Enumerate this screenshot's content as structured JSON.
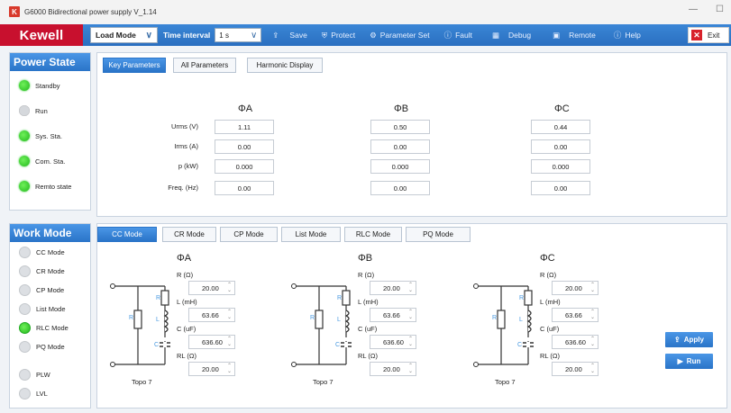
{
  "window": {
    "title": "G6000 Bidirectional power supply V_1.14",
    "logo_letter": "K",
    "min": "—",
    "max": "☐"
  },
  "toolbar": {
    "brand": "Kewell",
    "load_mode": "Load Mode",
    "time_interval_label": "Time interval",
    "time_interval_value": "1 s",
    "save": "Save",
    "protect": "Protect",
    "parameter_set": "Parameter Set",
    "fault": "Fault",
    "debug": "Debug",
    "remote": "Remote",
    "help": "Help",
    "exit": "Exit"
  },
  "power_state": {
    "title": "Power State",
    "items": [
      {
        "label": "Standby",
        "on": true
      },
      {
        "label": "Run",
        "on": false
      },
      {
        "label": "Sys. Sta.",
        "on": true
      },
      {
        "label": "Com. Sta.",
        "on": true
      },
      {
        "label": "Remto state",
        "on": true
      }
    ]
  },
  "work_mode": {
    "title": "Work Mode",
    "items": [
      {
        "label": "CC Mode",
        "on": false
      },
      {
        "label": "CR Mode",
        "on": false
      },
      {
        "label": "CP Mode",
        "on": false
      },
      {
        "label": "List Mode",
        "on": false
      },
      {
        "label": "RLC Mode",
        "on": true
      },
      {
        "label": "PQ Mode",
        "on": false
      },
      {
        "label": "PLW",
        "on": false
      },
      {
        "label": "LVL",
        "on": false
      }
    ]
  },
  "param_tabs": [
    "Key Parameters",
    "All Parameters",
    "Harmonic Display"
  ],
  "params": {
    "phases": [
      "ΦA",
      "ΦB",
      "ΦC"
    ],
    "rows": [
      {
        "label": "Urms (V)",
        "values": [
          "1.11",
          "0.50",
          "0.44"
        ]
      },
      {
        "label": "Irms (A)",
        "values": [
          "0.00",
          "0.00",
          "0.00"
        ]
      },
      {
        "label": "p (kW)",
        "values": [
          "0.000",
          "0.000",
          "0.000"
        ]
      },
      {
        "label": "Freq. (Hz)",
        "values": [
          "0.00",
          "0.00",
          "0.00"
        ]
      }
    ]
  },
  "mode_tabs": [
    "CC Mode",
    "CR Mode",
    "CP Mode",
    "List Mode",
    "RLC Mode",
    "PQ Mode"
  ],
  "rlc": {
    "phases": [
      {
        "name": "ΦA",
        "r_label": "R (Ω)",
        "r": "20.00",
        "l_label": "L (mH)",
        "l": "63.66",
        "c_label": "C (uF)",
        "c": "636.60",
        "rl_label": "RL (Ω)",
        "rl": "20.00",
        "topo": "Topo 7"
      },
      {
        "name": "ΦB",
        "r_label": "R (Ω)",
        "r": "20.00",
        "l_label": "L (mH)",
        "l": "63.66",
        "c_label": "C (uF)",
        "c": "636.60",
        "rl_label": "RL (Ω)",
        "rl": "20.00",
        "topo": "Topo 7"
      },
      {
        "name": "ΦC",
        "r_label": "R (Ω)",
        "r": "20.00",
        "l_label": "L (mH)",
        "l": "63.66",
        "c_label": "C (uF)",
        "c": "636.60",
        "rl_label": "RL (Ω)",
        "rl": "20.00",
        "topo": "Topo 7"
      }
    ],
    "circuit_labels": {
      "r": "R",
      "l": "L",
      "c": "C"
    }
  },
  "actions": {
    "apply": "Apply",
    "run": "Run"
  },
  "colors": {
    "accent": "#2a74c8",
    "brand": "#c8102e",
    "led_on": "#22b81c"
  }
}
